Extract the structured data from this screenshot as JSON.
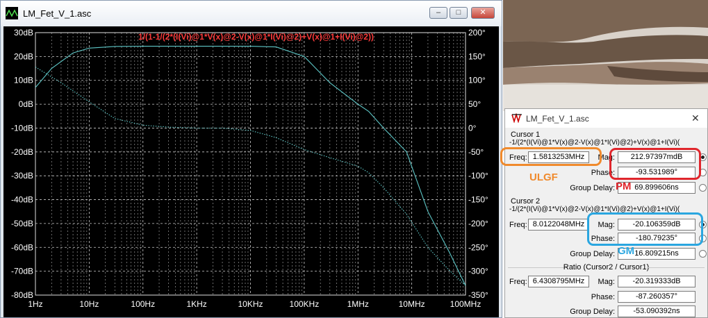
{
  "window": {
    "title": "LM_Fet_V_1.asc",
    "expression": "1/(1-1/(2*(I(Vi)@1*V(x)@2-V(x)@1*I(Vi)@2)+V(x)@1+I(Vi)@2))",
    "buttons": {
      "minimize": "–",
      "maximize": "□",
      "close": "✕"
    }
  },
  "chart_data": {
    "type": "line",
    "x_scale": "log",
    "xlim": [
      1,
      100000000
    ],
    "ylim_left": [
      -80,
      30
    ],
    "ylim_right": [
      -350,
      200
    ],
    "x_ticks": [
      {
        "v": 1,
        "label": "1Hz"
      },
      {
        "v": 10,
        "label": "10Hz"
      },
      {
        "v": 100,
        "label": "100Hz"
      },
      {
        "v": 1000,
        "label": "1KHz"
      },
      {
        "v": 10000,
        "label": "10KHz"
      },
      {
        "v": 100000,
        "label": "100KHz"
      },
      {
        "v": 1000000,
        "label": "1MHz"
      },
      {
        "v": 10000000,
        "label": "10MHz"
      },
      {
        "v": 100000000,
        "label": "100MHz"
      }
    ],
    "y_left_ticks": [
      {
        "v": 30,
        "label": "30dB"
      },
      {
        "v": 20,
        "label": "20dB"
      },
      {
        "v": 10,
        "label": "10dB"
      },
      {
        "v": 0,
        "label": "0dB"
      },
      {
        "v": -10,
        "label": "-10dB"
      },
      {
        "v": -20,
        "label": "-20dB"
      },
      {
        "v": -30,
        "label": "-30dB"
      },
      {
        "v": -40,
        "label": "-40dB"
      },
      {
        "v": -50,
        "label": "-50dB"
      },
      {
        "v": -60,
        "label": "-60dB"
      },
      {
        "v": -70,
        "label": "-70dB"
      },
      {
        "v": -80,
        "label": "-80dB"
      }
    ],
    "y_right_ticks": [
      {
        "v": 200,
        "label": "200°"
      },
      {
        "v": 150,
        "label": "150°"
      },
      {
        "v": 100,
        "label": "100°"
      },
      {
        "v": 50,
        "label": "50°"
      },
      {
        "v": 0,
        "label": "0°"
      },
      {
        "v": -50,
        "label": "-50°"
      },
      {
        "v": -100,
        "label": "-100°"
      },
      {
        "v": -150,
        "label": "-150°"
      },
      {
        "v": -200,
        "label": "-200°"
      },
      {
        "v": -250,
        "label": "-250°"
      },
      {
        "v": -300,
        "label": "-300°"
      },
      {
        "v": -350,
        "label": "-350°"
      }
    ],
    "series": [
      {
        "axis": "left",
        "style": "solid",
        "color": "#5ec8c8",
        "points": [
          [
            1,
            7
          ],
          [
            2,
            15
          ],
          [
            5,
            21.5
          ],
          [
            10,
            23.5
          ],
          [
            30,
            24.2
          ],
          [
            100,
            24.3
          ],
          [
            1000,
            24.3
          ],
          [
            10000,
            24.3
          ],
          [
            30000,
            24
          ],
          [
            100000,
            20
          ],
          [
            300000,
            9
          ],
          [
            1000000,
            0
          ],
          [
            1581325,
            -3
          ],
          [
            3000000,
            -10
          ],
          [
            8000000,
            -20
          ],
          [
            20000000,
            -45
          ],
          [
            50000000,
            -62
          ],
          [
            100000000,
            -76
          ]
        ]
      },
      {
        "axis": "right",
        "style": "dotted",
        "color": "#5ec8c8",
        "points": [
          [
            1,
            128
          ],
          [
            3,
            95
          ],
          [
            10,
            55
          ],
          [
            30,
            20
          ],
          [
            100,
            6
          ],
          [
            300,
            2
          ],
          [
            1000,
            0
          ],
          [
            3000,
            0
          ],
          [
            10000,
            -5
          ],
          [
            30000,
            -20
          ],
          [
            100000,
            -45
          ],
          [
            300000,
            -62
          ],
          [
            1000000,
            -80
          ],
          [
            1581325,
            -93.5
          ],
          [
            3000000,
            -125
          ],
          [
            8012204,
            -180.8
          ],
          [
            20000000,
            -250
          ],
          [
            50000000,
            -298
          ],
          [
            100000000,
            -330
          ]
        ]
      }
    ]
  },
  "cursor_window": {
    "title": "LM_Fet_V_1.asc",
    "close": "✕",
    "cursor1": {
      "title": "Cursor 1",
      "expr": "-1/(2*(I(Vi)@1*V(x)@2-V(x)@1*I(Vi)@2)+V(x)@1+I(Vi)(",
      "freq_label": "Freq:",
      "freq": "1.5813253MHz",
      "mag_label": "Mag:",
      "mag": "212.97397mdB",
      "phase_label": "Phase:",
      "phase": "-93.531989°",
      "gd_label": "Group Delay:",
      "gd": "69.899606ns"
    },
    "cursor2": {
      "title": "Cursor 2",
      "expr": "-1/(2*(I(Vi)@1*V(x)@2-V(x)@1*I(Vi)@2)+V(x)@1+I(Vi)(",
      "freq_label": "Freq:",
      "freq": "8.0122048MHz",
      "mag_label": "Mag:",
      "mag": "-20.106359dB",
      "phase_label": "Phase:",
      "phase": "-180.79235°",
      "gd_label": "Group Delay:",
      "gd": "16.809215ns"
    },
    "ratio": {
      "title": "Ratio (Cursor2 / Cursor1)",
      "freq_label": "Freq:",
      "freq": "6.4308795MHz",
      "mag_label": "Mag:",
      "mag": "-20.319333dB",
      "phase_label": "Phase:",
      "phase": "-87.260357°",
      "gd_label": "Group Delay:",
      "gd": "-53.090392ns"
    }
  },
  "annotations": {
    "ulgf": "ULGF",
    "pm": "PM",
    "gm": "GM",
    "colors": {
      "ulgf": "#f08a2c",
      "pm": "#e0262c",
      "gm": "#2aa6e0"
    }
  },
  "colors": {
    "trace": "#5ec8c8",
    "expression": "#ff3b3b",
    "grid": "#d0d0d0",
    "axis_text": "#ffffff"
  }
}
